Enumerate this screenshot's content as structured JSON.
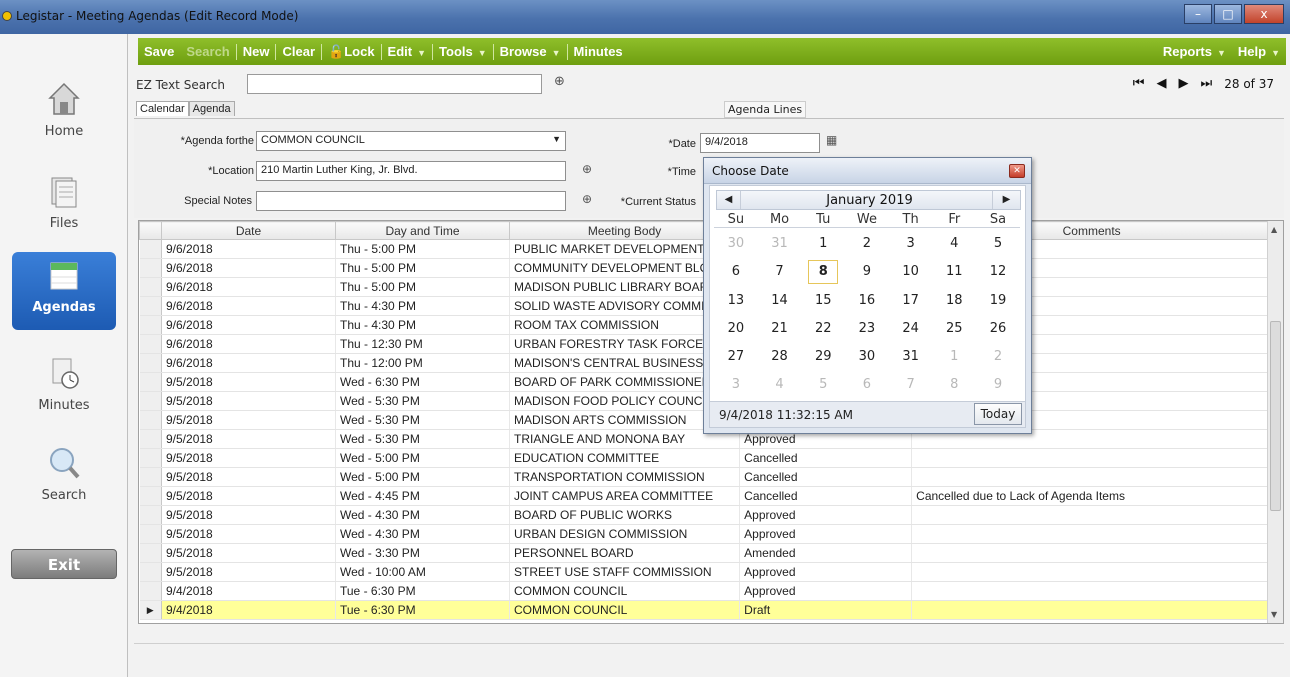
{
  "window": {
    "title": "Legistar - Meeting Agendas (Edit Record Mode)",
    "min_label": "–",
    "max_label": "□",
    "close_label": "x"
  },
  "nav": {
    "home": "Home",
    "files": "Files",
    "agendas": "Agendas",
    "minutes": "Minutes",
    "search": "Search",
    "exit": "Exit"
  },
  "toolbar": {
    "save": "Save",
    "search": "Search",
    "new": "New",
    "clear": "Clear",
    "lock": "Lock",
    "edit": "Edit",
    "tools": "Tools",
    "browse": "Browse",
    "minutes": "Minutes",
    "reports": "Reports",
    "help": "Help"
  },
  "ez": {
    "label": "EZ Text Search",
    "value": ""
  },
  "record": {
    "current": "28",
    "of_label": "of",
    "total": "37"
  },
  "tabs": {
    "calendar": "Calendar",
    "agenda": "Agenda",
    "agenda_lines": "Agenda Lines"
  },
  "form": {
    "agenda_for_label": "*Agenda forthe",
    "agenda_for_value": "COMMON COUNCIL",
    "date_label": "*Date",
    "date_value": "9/4/2018",
    "location_label": "*Location",
    "location_value": "210 Martin Luther King, Jr. Blvd.",
    "time_label": "*Time",
    "notes_label": "Special Notes",
    "notes_value": "",
    "status_label": "*Current Status"
  },
  "grid": {
    "columns": [
      "Date",
      "Day and Time",
      "Meeting Body",
      "",
      "Comments"
    ],
    "rows": [
      {
        "date": "9/6/2018",
        "time": "Thu - 5:00 PM",
        "body": "PUBLIC MARKET DEVELOPMENT",
        "status": "",
        "comment": ""
      },
      {
        "date": "9/6/2018",
        "time": "Thu - 5:00 PM",
        "body": "COMMUNITY DEVELOPMENT BLOCK",
        "status": "",
        "comment": ""
      },
      {
        "date": "9/6/2018",
        "time": "Thu - 5:00 PM",
        "body": "MADISON PUBLIC LIBRARY BOARD",
        "status": "",
        "comment": ""
      },
      {
        "date": "9/6/2018",
        "time": "Thu - 4:30 PM",
        "body": "SOLID WASTE ADVISORY COMMITTEE",
        "status": "",
        "comment": ""
      },
      {
        "date": "9/6/2018",
        "time": "Thu - 4:30 PM",
        "body": "ROOM TAX COMMISSION",
        "status": "",
        "comment": ""
      },
      {
        "date": "9/6/2018",
        "time": "Thu - 12:30 PM",
        "body": "URBAN FORESTRY TASK FORCE",
        "status": "",
        "comment": ""
      },
      {
        "date": "9/6/2018",
        "time": "Thu - 12:00 PM",
        "body": "MADISON'S CENTRAL BUSINESS",
        "status": "",
        "comment": ""
      },
      {
        "date": "9/5/2018",
        "time": "Wed - 6:30 PM",
        "body": "BOARD OF PARK COMMISSIONERS",
        "status": "",
        "comment": ""
      },
      {
        "date": "9/5/2018",
        "time": "Wed - 5:30 PM",
        "body": "MADISON FOOD POLICY COUNCIL",
        "status": "",
        "comment": ""
      },
      {
        "date": "9/5/2018",
        "time": "Wed - 5:30 PM",
        "body": "MADISON ARTS COMMISSION",
        "status": "",
        "comment": "ipate via phone"
      },
      {
        "date": "9/5/2018",
        "time": "Wed - 5:30 PM",
        "body": "TRIANGLE AND MONONA BAY",
        "status": "Approved",
        "comment": ""
      },
      {
        "date": "9/5/2018",
        "time": "Wed - 5:00 PM",
        "body": "EDUCATION COMMITTEE",
        "status": "Cancelled",
        "comment": ""
      },
      {
        "date": "9/5/2018",
        "time": "Wed - 5:00 PM",
        "body": "TRANSPORTATION COMMISSION",
        "status": "Cancelled",
        "comment": ""
      },
      {
        "date": "9/5/2018",
        "time": "Wed - 4:45 PM",
        "body": "JOINT CAMPUS AREA COMMITTEE",
        "status": "Cancelled",
        "comment": "Cancelled due to Lack of Agenda Items"
      },
      {
        "date": "9/5/2018",
        "time": "Wed - 4:30 PM",
        "body": "BOARD OF PUBLIC WORKS",
        "status": "Approved",
        "comment": ""
      },
      {
        "date": "9/5/2018",
        "time": "Wed - 4:30 PM",
        "body": "URBAN DESIGN COMMISSION",
        "status": "Approved",
        "comment": ""
      },
      {
        "date": "9/5/2018",
        "time": "Wed - 3:30 PM",
        "body": "PERSONNEL BOARD",
        "status": "Amended",
        "comment": ""
      },
      {
        "date": "9/5/2018",
        "time": "Wed - 10:00 AM",
        "body": "STREET USE STAFF COMMISSION",
        "status": "Approved",
        "comment": ""
      },
      {
        "date": "9/4/2018",
        "time": "Tue - 6:30 PM",
        "body": "COMMON COUNCIL",
        "status": "Approved",
        "comment": ""
      },
      {
        "date": "9/4/2018",
        "time": "Tue - 6:30 PM",
        "body": "COMMON COUNCIL",
        "status": "Draft",
        "comment": "",
        "selected": true
      }
    ]
  },
  "datepicker": {
    "title": "Choose Date",
    "month": "January 2019",
    "dow": [
      "Su",
      "Mo",
      "Tu",
      "We",
      "Th",
      "Fr",
      "Sa"
    ],
    "days": [
      {
        "d": "30",
        "other": true
      },
      {
        "d": "31",
        "other": true
      },
      {
        "d": "1"
      },
      {
        "d": "2"
      },
      {
        "d": "3"
      },
      {
        "d": "4"
      },
      {
        "d": "5"
      },
      {
        "d": "6"
      },
      {
        "d": "7"
      },
      {
        "d": "8",
        "today": true
      },
      {
        "d": "9"
      },
      {
        "d": "10"
      },
      {
        "d": "11"
      },
      {
        "d": "12"
      },
      {
        "d": "13"
      },
      {
        "d": "14"
      },
      {
        "d": "15"
      },
      {
        "d": "16"
      },
      {
        "d": "17"
      },
      {
        "d": "18"
      },
      {
        "d": "19"
      },
      {
        "d": "20"
      },
      {
        "d": "21"
      },
      {
        "d": "22"
      },
      {
        "d": "23"
      },
      {
        "d": "24"
      },
      {
        "d": "25"
      },
      {
        "d": "26"
      },
      {
        "d": "27"
      },
      {
        "d": "28"
      },
      {
        "d": "29"
      },
      {
        "d": "30"
      },
      {
        "d": "31"
      },
      {
        "d": "1",
        "other": true
      },
      {
        "d": "2",
        "other": true
      },
      {
        "d": "3",
        "other": true
      },
      {
        "d": "4",
        "other": true
      },
      {
        "d": "5",
        "other": true
      },
      {
        "d": "6",
        "other": true
      },
      {
        "d": "7",
        "other": true
      },
      {
        "d": "8",
        "other": true
      },
      {
        "d": "9",
        "other": true
      }
    ],
    "current_datetime": "9/4/2018 11:32:15 AM",
    "today_label": "Today"
  },
  "colors": {
    "toolbar_green": "#7aa81a",
    "nav_active_blue": "#2a6ec6",
    "selected_row": "#ffff99"
  }
}
